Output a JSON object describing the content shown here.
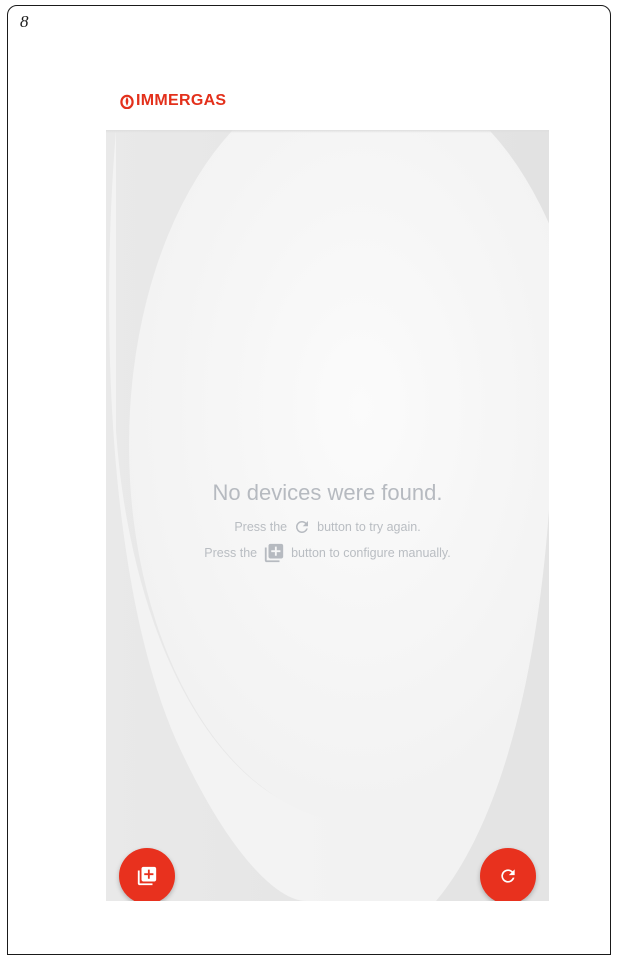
{
  "page": {
    "number": "8"
  },
  "brand": {
    "logo_text": "IMMERGAS",
    "color": "#e3301b"
  },
  "screen": {
    "message": {
      "title": "No devices were found.",
      "line1_before": "Press the",
      "line1_icon": "refresh-icon",
      "line1_after": "button to try again.",
      "line2_before": "Press the",
      "line2_icon": "add-device-icon",
      "line2_after": "button to configure manually."
    },
    "buttons": {
      "add_icon": "add-device-icon",
      "refresh_icon": "refresh-icon",
      "accent_color": "#e8311e"
    }
  }
}
